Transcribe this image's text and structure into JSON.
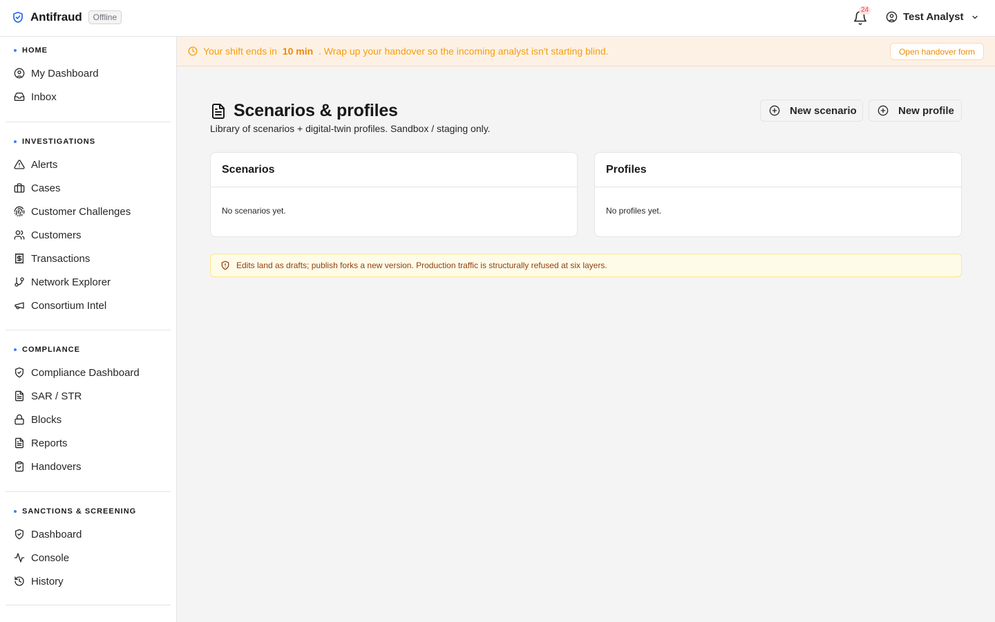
{
  "app": {
    "name": "Antifraud",
    "status": "Offline",
    "notifications": "24",
    "user": "Test Analyst"
  },
  "sidebar": {
    "sections": [
      {
        "title": "HOME",
        "items": [
          {
            "label": "My Dashboard",
            "icon": "user-circle-icon"
          },
          {
            "label": "Inbox",
            "icon": "inbox-icon"
          }
        ]
      },
      {
        "title": "INVESTIGATIONS",
        "items": [
          {
            "label": "Alerts",
            "icon": "alert-triangle-icon"
          },
          {
            "label": "Cases",
            "icon": "briefcase-icon"
          },
          {
            "label": "Customer Challenges",
            "icon": "fingerprint-icon"
          },
          {
            "label": "Customers",
            "icon": "users-icon"
          },
          {
            "label": "Transactions",
            "icon": "receipt-dollar-icon"
          },
          {
            "label": "Network Explorer",
            "icon": "git-branch-icon"
          },
          {
            "label": "Consortium Intel",
            "icon": "megaphone-icon"
          }
        ]
      },
      {
        "title": "COMPLIANCE",
        "items": [
          {
            "label": "Compliance Dashboard",
            "icon": "shield-check-icon"
          },
          {
            "label": "SAR / STR",
            "icon": "file-text-icon"
          },
          {
            "label": "Blocks",
            "icon": "lock-icon"
          },
          {
            "label": "Reports",
            "icon": "file-text-icon"
          },
          {
            "label": "Handovers",
            "icon": "clipboard-check-icon"
          }
        ]
      },
      {
        "title": "SANCTIONS & SCREENING",
        "items": [
          {
            "label": "Dashboard",
            "icon": "shield-check-icon"
          },
          {
            "label": "Console",
            "icon": "activity-icon"
          },
          {
            "label": "History",
            "icon": "history-icon"
          }
        ]
      }
    ]
  },
  "banner": {
    "prefix": "Your shift ends in",
    "time": "10 min",
    "suffix": ". Wrap up your handover so the incoming analyst isn't starting blind.",
    "button": "Open handover form"
  },
  "page": {
    "title": "Scenarios & profiles",
    "subtitle": "Library of scenarios + digital-twin profiles. Sandbox / staging only.",
    "new_scenario": "New scenario",
    "new_profile": "New profile"
  },
  "cards": {
    "scenarios": {
      "title": "Scenarios",
      "empty": "No scenarios yet."
    },
    "profiles": {
      "title": "Profiles",
      "empty": "No profiles yet."
    }
  },
  "note": "Edits land as drafts; publish forks a new version. Production traffic is structurally refused at six layers.",
  "colors": {
    "accent": "#3b82f6",
    "warning_text": "#f59e0b",
    "banner_bg": "#fdf1e6",
    "note_bg": "#fefbe8"
  }
}
